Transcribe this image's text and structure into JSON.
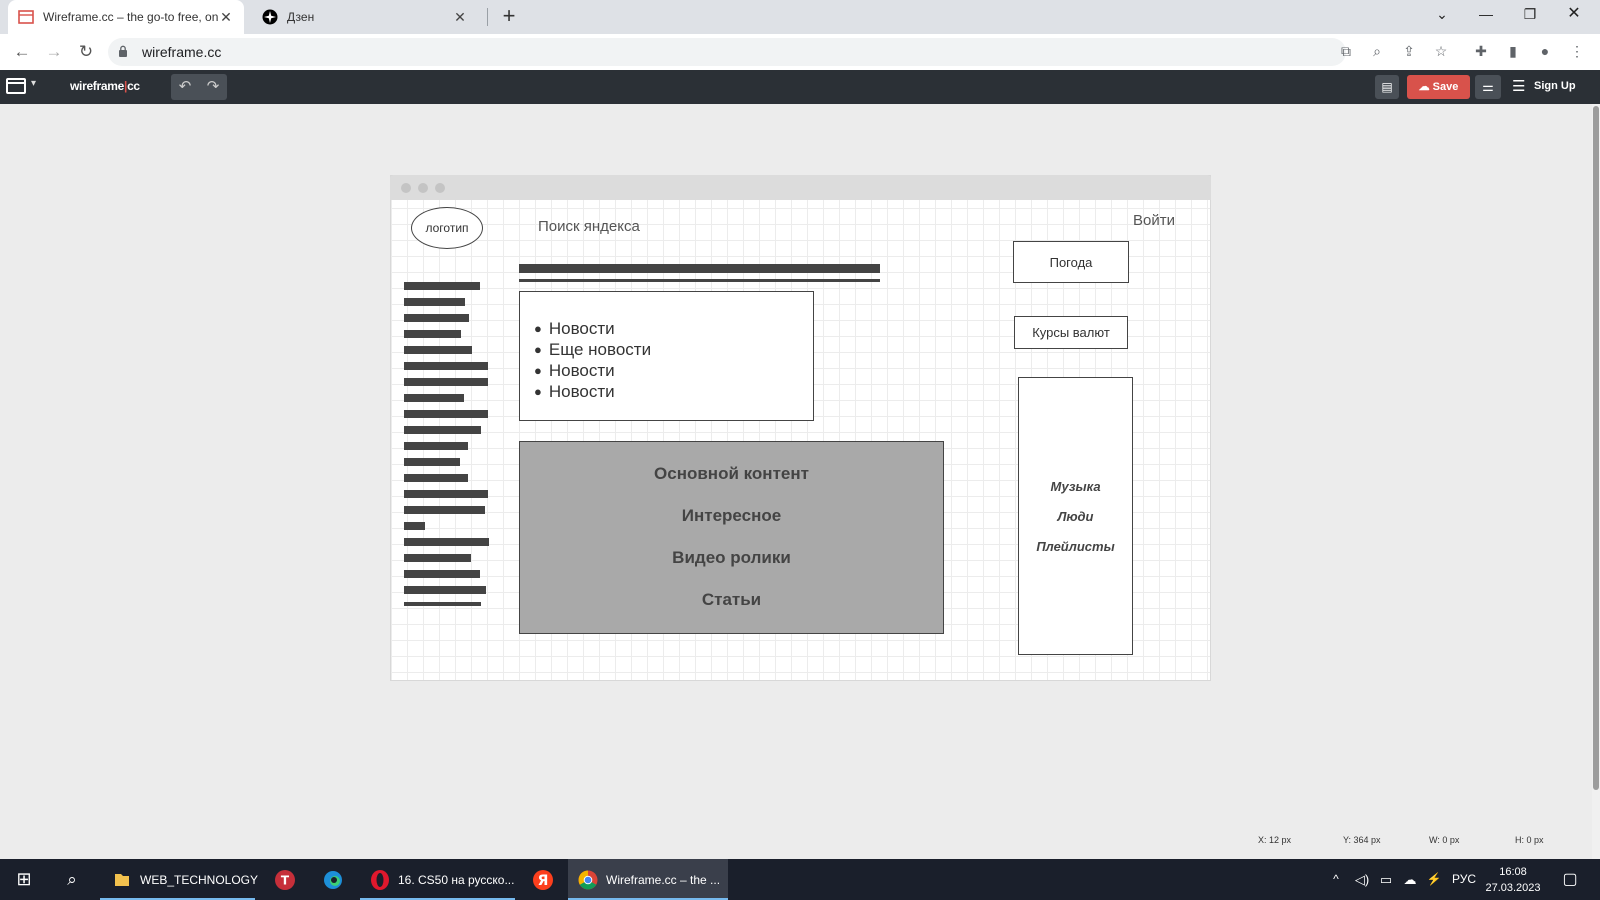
{
  "browser": {
    "tabs": [
      {
        "title": "Wireframe.cc – the go-to free, on",
        "icon": "wireframe-favicon"
      },
      {
        "title": "Дзен",
        "icon": "dzen-favicon"
      }
    ],
    "url": "wireframe.cc"
  },
  "toolbar": {
    "logo_left": "wireframe",
    "logo_right": "cc",
    "save_label": "Save",
    "signup_label": "Sign Up",
    "accent_color": "#d8524b"
  },
  "wireframe": {
    "logo_label": "логотип",
    "search_label": "Поиск яндекса",
    "login_label": "Войти",
    "news_items": [
      "Новости",
      "Еще новости",
      "Новости",
      "Новости"
    ],
    "main_items": [
      "Основной контент",
      "Интересное",
      "Видео ролики",
      "Статьи"
    ],
    "weather_label": "Погода",
    "currency_label": "Курсы валют",
    "music_items": [
      "Музыка",
      "Люди",
      "Плейлисты"
    ]
  },
  "statusbar": {
    "x": "X: 12 px",
    "y": "Y: 364 px",
    "w": "W: 0 px",
    "h": "H: 0 px"
  },
  "taskbar": {
    "items": [
      {
        "label": "WEB_TECHNOLOGY",
        "icon": "folder-icon"
      },
      {
        "label": "",
        "icon": "t-app-icon"
      },
      {
        "label": "",
        "icon": "edge-icon"
      },
      {
        "label": "16. CS50 на русско...",
        "icon": "opera-icon"
      },
      {
        "label": "",
        "icon": "yandex-icon"
      },
      {
        "label": "Wireframe.cc – the ...",
        "icon": "chrome-icon"
      }
    ],
    "language": "РУС",
    "time": "16:08",
    "date": "27.03.2023"
  }
}
